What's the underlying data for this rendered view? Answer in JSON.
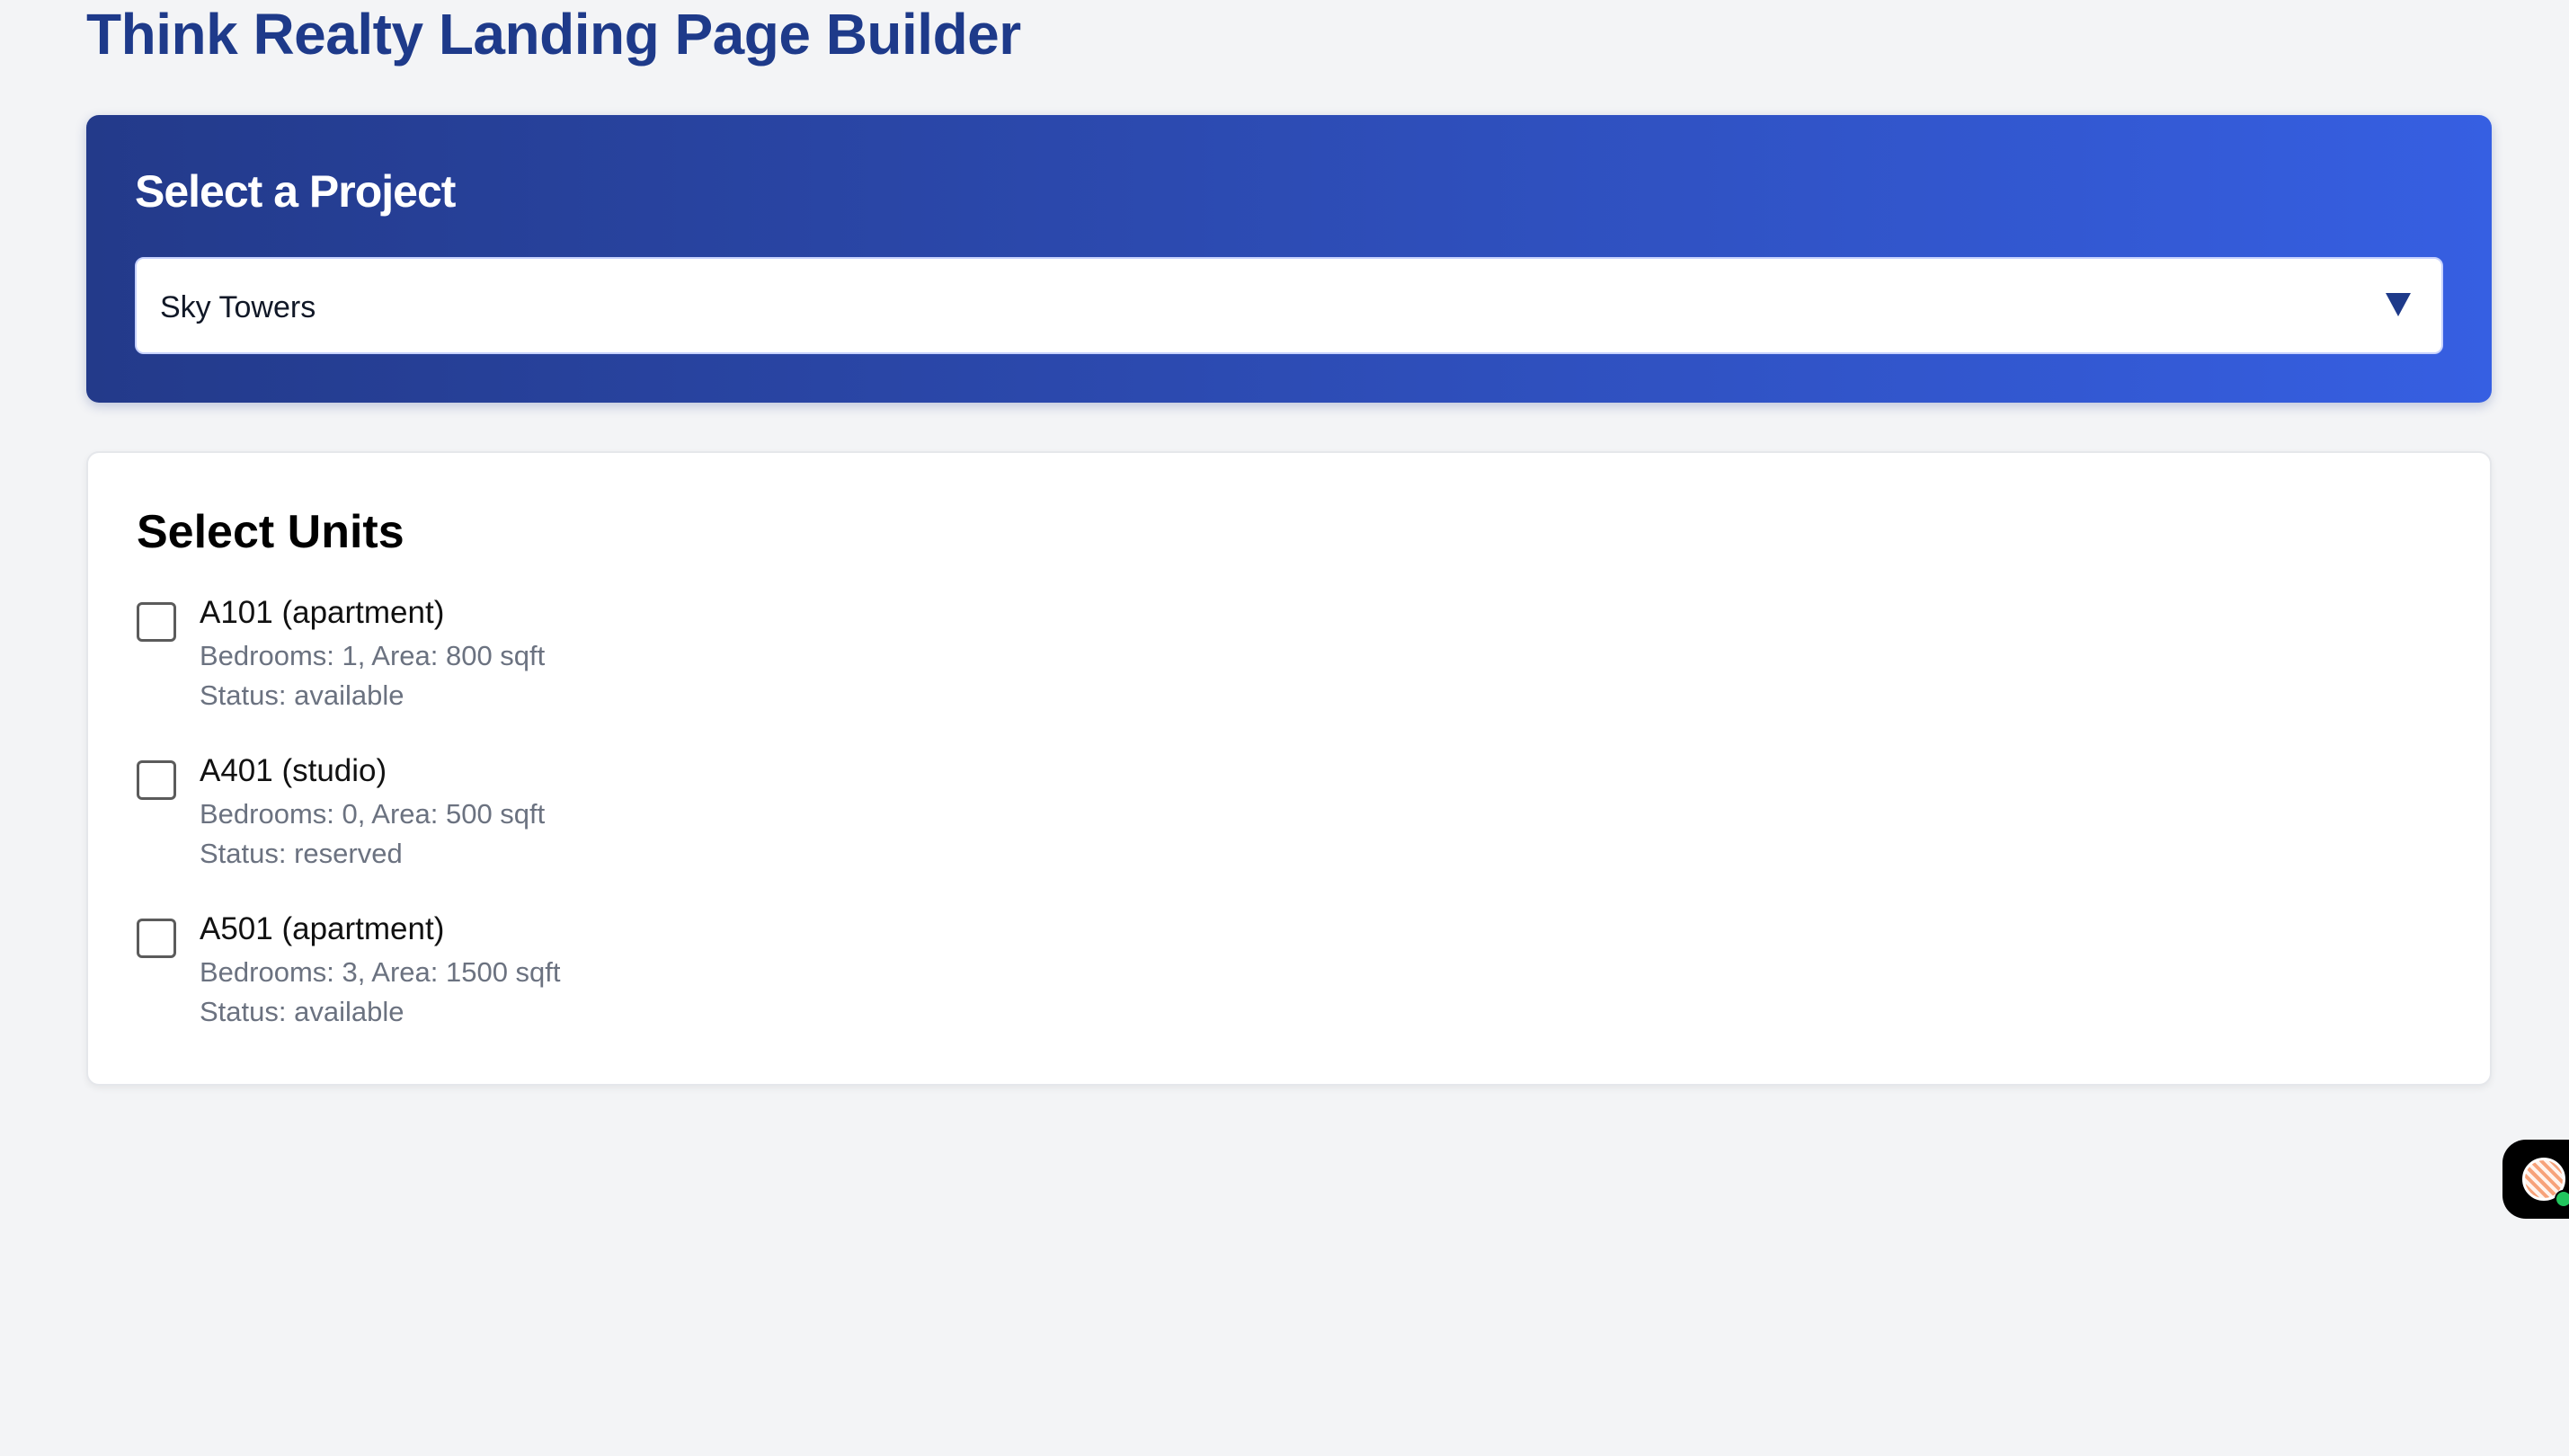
{
  "header": {
    "title": "Think Realty Landing Page Builder"
  },
  "project_selector": {
    "heading": "Select a Project",
    "selected_value": "Sky Towers",
    "icon": "chevron-down-icon"
  },
  "units": {
    "heading": "Select Units",
    "items": [
      {
        "name": "A101 (apartment)",
        "details": "Bedrooms: 1, Area: 800 sqft",
        "status": "Status: available",
        "checked": false
      },
      {
        "name": "A401 (studio)",
        "details": "Bedrooms: 0, Area: 500 sqft",
        "status": "Status: reserved",
        "checked": false
      },
      {
        "name": "A501 (apartment)",
        "details": "Bedrooms: 3, Area: 1500 sqft",
        "status": "Status: available",
        "checked": false
      }
    ]
  },
  "floating_widget": {
    "icon": "assistant-avatar-icon",
    "status_color": "#22c55e"
  },
  "colors": {
    "brand": "#1e3a8a",
    "accent": "#365fe2",
    "background": "#f3f4f6"
  }
}
